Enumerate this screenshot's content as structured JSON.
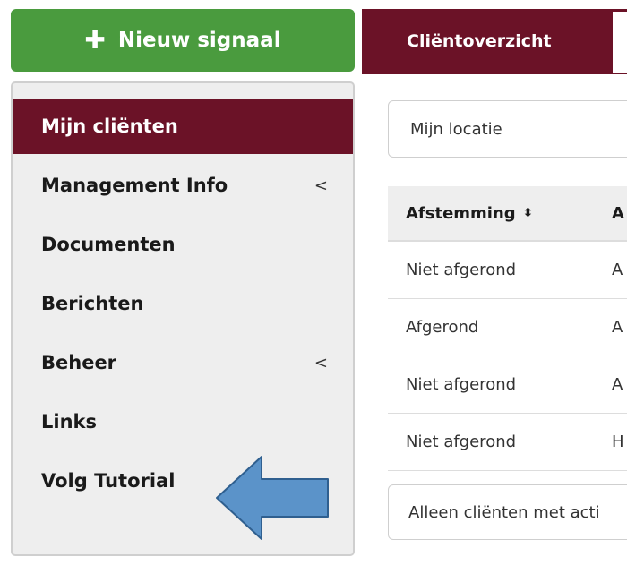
{
  "actions": {
    "new_signal_label": "Nieuw signaal",
    "plus_icon": "plus-icon"
  },
  "sidebar": {
    "items": [
      {
        "label": "Mijn cliënten",
        "active": true,
        "has_chevron": false
      },
      {
        "label": "Management Info",
        "active": false,
        "has_chevron": true
      },
      {
        "label": "Documenten",
        "active": false,
        "has_chevron": false
      },
      {
        "label": "Berichten",
        "active": false,
        "has_chevron": false
      },
      {
        "label": "Beheer",
        "active": false,
        "has_chevron": true
      },
      {
        "label": "Links",
        "active": false,
        "has_chevron": false
      },
      {
        "label": "Volg Tutorial",
        "active": false,
        "has_chevron": false
      }
    ],
    "chevron_glyph": "<",
    "pointer_icon": "arrow-left-icon"
  },
  "tabs": [
    {
      "label": "Cliëntoverzicht",
      "active": true
    },
    {
      "label": "",
      "active": false
    }
  ],
  "location_select": {
    "value": "Mijn locatie"
  },
  "table": {
    "columns": [
      {
        "label": "Afstemming",
        "sortable": true
      },
      {
        "label": "A",
        "sortable": false
      }
    ],
    "rows": [
      [
        "Niet afgerond",
        "A"
      ],
      [
        "Afgerond",
        "A"
      ],
      [
        "Niet afgerond",
        "A"
      ],
      [
        "Niet afgerond",
        "H"
      ]
    ],
    "sort_glyph": "⬍"
  },
  "filter": {
    "label": "Alleen cliënten met acti"
  },
  "colors": {
    "brand_maroon": "#6b1227",
    "action_green": "#4a9b3e",
    "pointer_blue": "#5b93c9"
  }
}
